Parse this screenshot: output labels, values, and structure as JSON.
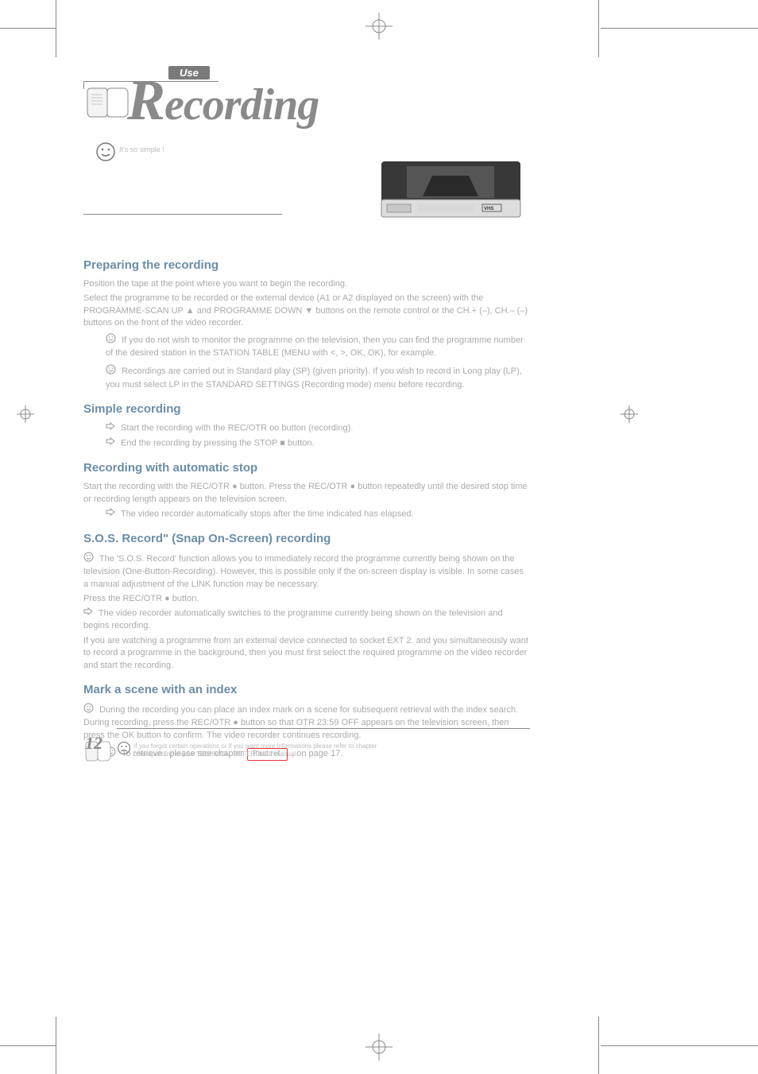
{
  "header": {
    "tab": "Use",
    "title_letter": "R",
    "title_rest": "ecording",
    "smiley_caption": "It's so simple !"
  },
  "sections": {
    "prep": {
      "heading": "Preparing the recording",
      "p1": "Position the tape at the point where you want to begin the recording.",
      "p2": "Select the programme to be recorded or the external device (A1 or A2 displayed on the screen) with the PROGRAMME-SCAN UP ▲ and PROGRAMME DOWN ▼ buttons on the remote control or the CH.+ (–), CH.– (–) buttons on the front of the video recorder.",
      "tip1": "If you do not wish to monitor the programme on the television, then you can find the programme number of the desired station in the STATION TABLE (MENU with <, >, OK, OK), for example.",
      "tip2": "Recordings are carried out in Standard play (SP) (given priority). If you wish to record in Long play (LP), you must select LP in the STANDARD SETTINGS (Recording mode) menu before recording."
    },
    "simple": {
      "heading": "Simple recording",
      "r1": "Start the recording with the REC/OTR oo button (recording).",
      "r2": "End the recording by pressing the STOP ■ button."
    },
    "auto": {
      "heading": "Recording with automatic stop",
      "p1": "Start the recording with the REC/OTR ● button. Press the REC/OTR ● button repeatedly until the desired stop time or recording length appears on the television screen.",
      "r1": "The video recorder automatically stops after the time indicated has elapsed."
    },
    "sos": {
      "heading": "S.O.S. Record\" (Snap On-Screen) recording",
      "tip1": "The 'S.O.S. Record' function allows you to immediately record the programme currently being shown on the television (One-Button-Recording). However, this is possible only if the on-screen display is visible. In some cases a manual adjustment of the LINK function may be necessary.",
      "p1": "Press the REC/OTR ● button.",
      "r1": "The video recorder automatically switches to the programme currently being shown on the television and begins recording.",
      "p2": "If you are watching a programme from an external device connected to socket EXT 2. and you simultaneously want to record a programme in the background, then you must first select the required programme on the video recorder and start the recording."
    },
    "index": {
      "heading": "Mark a scene with an index",
      "tip1": "During the recording you can place an index mark on a scene for subsequent retrieval with the index search. During recording, press the REC/OTR ● button so that OTR 23:59 OFF appears on the television screen, then press the OK button to confirm. The video recorder continues recording.",
      "tip2": "To retrieve : please see chapter",
      "fastref": "Fast ref.",
      "tip2_after": ", on page 17."
    }
  },
  "footer": {
    "page_num": "12",
    "sad_note_1": "If you forgot certain operations or if you want more informations please refer to chapter",
    "sad_note_2": "corresponding in your TECHNICAL REFERENCE manual."
  }
}
